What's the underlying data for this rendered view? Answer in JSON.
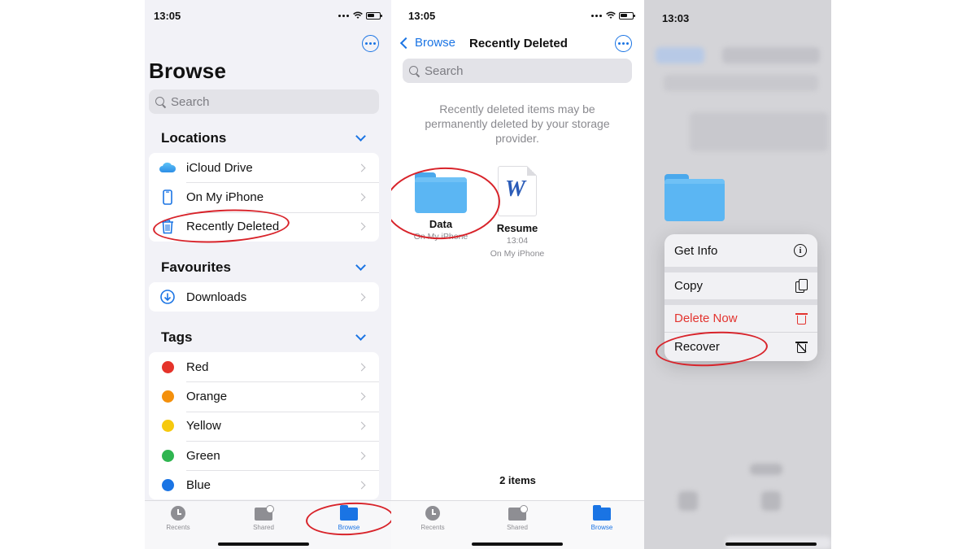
{
  "panel1": {
    "time": "13:05",
    "title": "Browse",
    "search_placeholder": "Search",
    "locations": {
      "heading": "Locations",
      "items": [
        {
          "label": "iCloud Drive",
          "icon": "cloud-icon"
        },
        {
          "label": "On My iPhone",
          "icon": "iphone-icon"
        },
        {
          "label": "Recently Deleted",
          "icon": "trash-icon"
        }
      ]
    },
    "favourites": {
      "heading": "Favourites",
      "items": [
        {
          "label": "Downloads",
          "icon": "download-icon"
        }
      ]
    },
    "tags": {
      "heading": "Tags",
      "items": [
        {
          "label": "Red",
          "color": "#e5332a"
        },
        {
          "label": "Orange",
          "color": "#f4900c"
        },
        {
          "label": "Yellow",
          "color": "#f6c90e"
        },
        {
          "label": "Green",
          "color": "#2fb550"
        },
        {
          "label": "Blue",
          "color": "#1a74e4"
        }
      ]
    },
    "tabs": [
      {
        "label": "Recents",
        "icon": "clock-icon"
      },
      {
        "label": "Shared",
        "icon": "shared-folder-icon"
      },
      {
        "label": "Browse",
        "icon": "browse-folder-icon",
        "active": true
      }
    ]
  },
  "panel2": {
    "time": "13:05",
    "back_label": "Browse",
    "title": "Recently Deleted",
    "search_placeholder": "Search",
    "notice": "Recently deleted items may be permanently deleted by your storage provider.",
    "files": [
      {
        "name": "Data",
        "meta_time": "",
        "meta_location": "On My iPhone",
        "icon": "folder-icon"
      },
      {
        "name": "Resume",
        "meta_time": "13:04",
        "meta_location": "On My iPhone",
        "icon": "word-document-icon"
      }
    ],
    "item_count": "2 items",
    "tabs": [
      {
        "label": "Recents",
        "icon": "clock-icon"
      },
      {
        "label": "Shared",
        "icon": "shared-folder-icon"
      },
      {
        "label": "Browse",
        "icon": "browse-folder-icon",
        "active": true
      }
    ]
  },
  "panel3": {
    "time": "13:03",
    "menu": [
      {
        "label": "Get Info",
        "icon": "info-icon"
      },
      {
        "label": "Copy",
        "icon": "copy-icon"
      },
      {
        "label": "Delete Now",
        "icon": "trash-icon",
        "destructive": true
      },
      {
        "label": "Recover",
        "icon": "recover-icon"
      }
    ]
  },
  "colors": {
    "accent": "#1a74e4",
    "destructive": "#e3342f",
    "annotation": "#d8232a"
  }
}
